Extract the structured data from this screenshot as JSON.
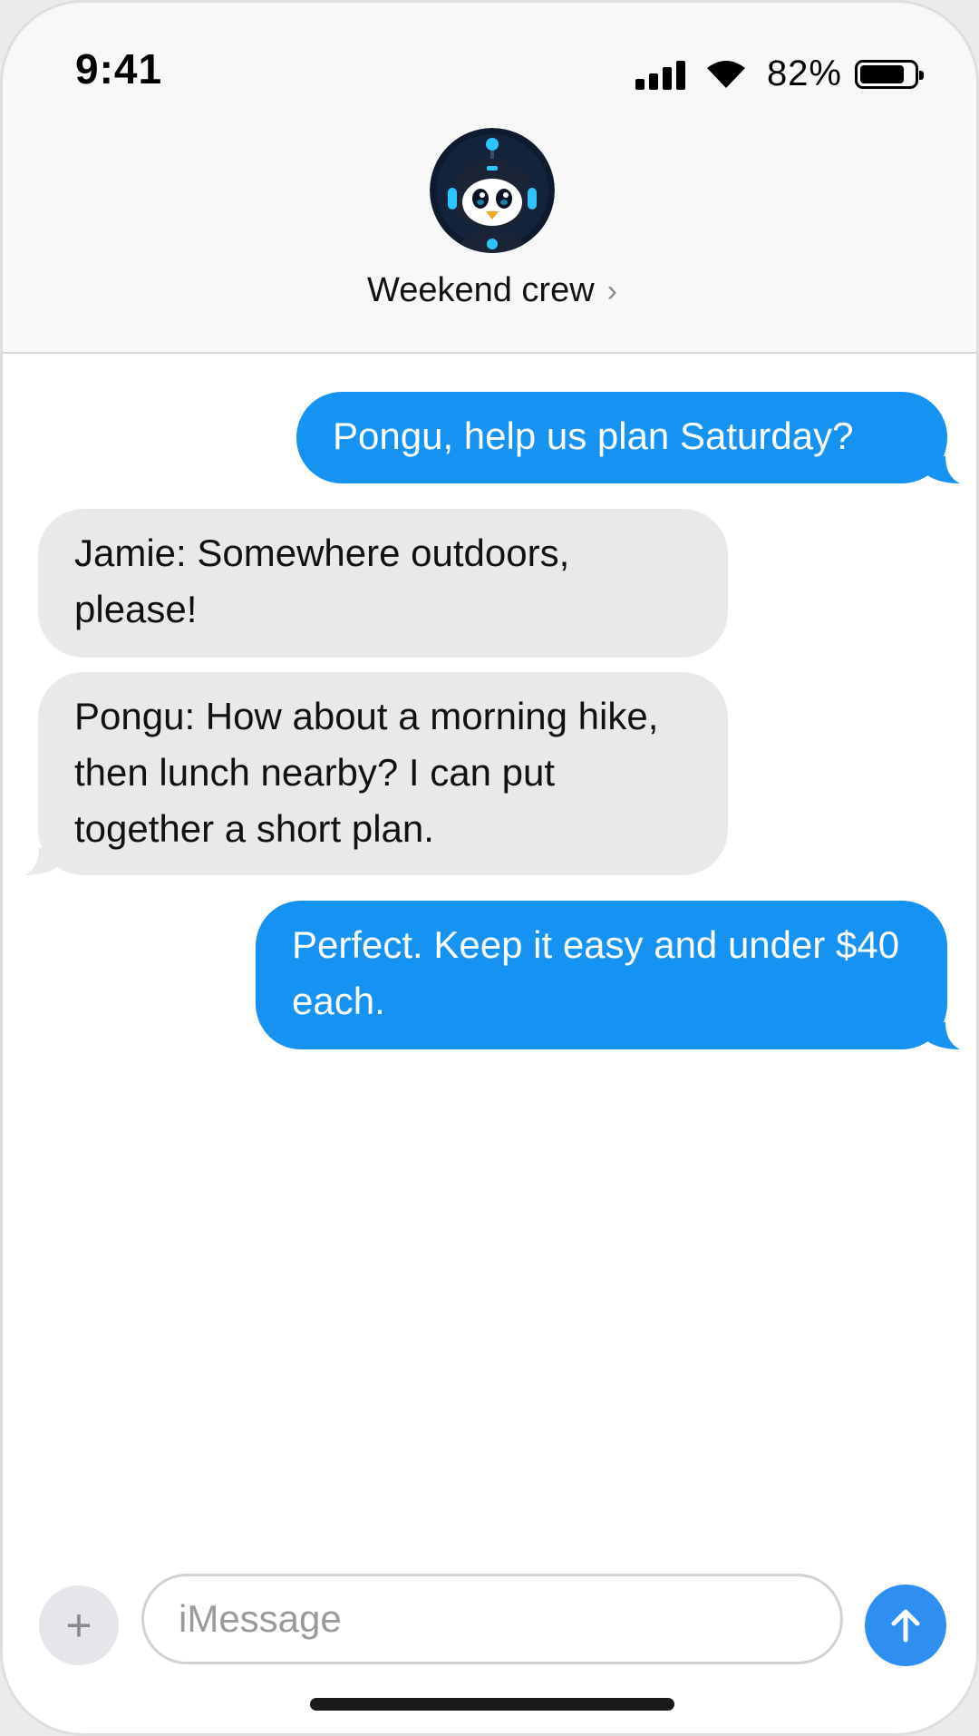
{
  "status_bar": {
    "time": "9:41",
    "battery_percent": "82%",
    "battery_level": 0.82
  },
  "header": {
    "title": "Weekend crew",
    "chevron": "›",
    "avatar_icon": "penguin-robot-avatar"
  },
  "messages": [
    {
      "direction": "outgoing",
      "text": "Pongu, help us plan Saturday?"
    },
    {
      "direction": "incoming",
      "text": "Jamie: Somewhere outdoors, please!"
    },
    {
      "direction": "incoming",
      "text": "Pongu: How about a morning hike, then lunch nearby? I can put together a short plan."
    },
    {
      "direction": "outgoing",
      "text": "Perfect. Keep it easy and under $40 each."
    }
  ],
  "composer": {
    "plus_label": "+",
    "placeholder": "iMessage",
    "send_icon": "arrow-up-icon"
  },
  "colors": {
    "outgoing_bubble": "#1693f2",
    "incoming_bubble": "#e9e9eb",
    "send_button": "#2f8ff0"
  }
}
